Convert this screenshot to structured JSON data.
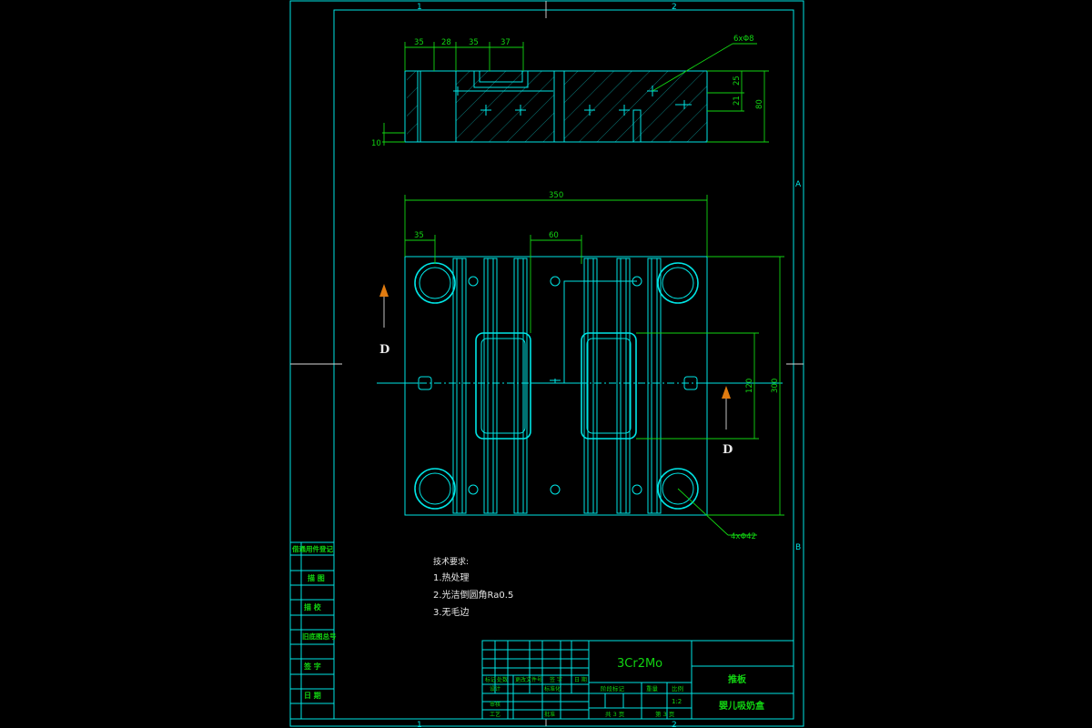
{
  "sheet": {
    "zone_labels": [
      "1",
      "2",
      "A",
      "B",
      "1",
      "2"
    ]
  },
  "section_view": {
    "dims": [
      "35",
      "28",
      "35",
      "37",
      "6xΦ8",
      "25",
      "21",
      "80",
      "10"
    ]
  },
  "plan_view": {
    "dim_overall_width": "350",
    "dim_edge": "35",
    "dim_gap": "60",
    "dim_height": "300",
    "dim_window": "120",
    "callout_holes": "4xΦ42",
    "section_marker_left": "D",
    "section_marker_right": "D"
  },
  "notes": {
    "heading": "技术要求:",
    "items": [
      "1.热处理",
      "2.光洁倒圆角Ra0.5",
      "3.无毛边"
    ]
  },
  "side_column": {
    "labels": [
      "借通用件登记",
      "描 图",
      "描 校",
      "旧底图总号",
      "签 字",
      "日 期"
    ]
  },
  "title_block": {
    "material": "3Cr2Mo",
    "part_name": "推板",
    "product_name": "婴儿吸奶盒",
    "grid_headers": [
      "标记",
      "处数",
      "更改文件号",
      "签 字",
      "日 期"
    ],
    "designer_label": "设计",
    "standard_label": "标准化",
    "review_label": "审核",
    "process_label": "工艺",
    "approve_label": "批准",
    "stage_label": "阶段标记",
    "weight_label": "重量",
    "scale_label": "比例",
    "scale_value": "1:2",
    "sheets_total": "共 3 页",
    "sheet_no": "第 3 页"
  },
  "colors": {
    "background": "#000000",
    "drawing_cyan": "#00e5e5",
    "dimension_green": "#12d412",
    "arrow_orange": "#e07b10"
  }
}
